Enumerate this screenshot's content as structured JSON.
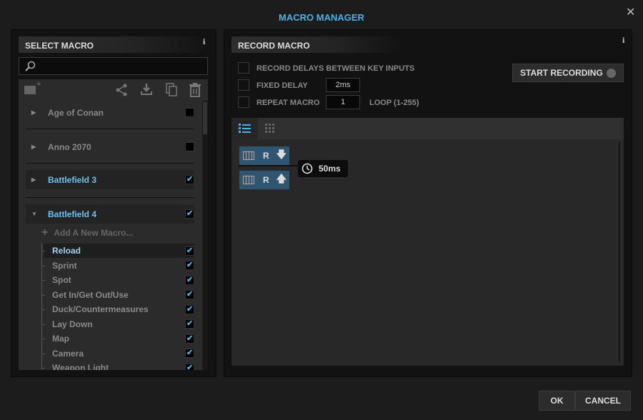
{
  "window": {
    "title": "MACRO MANAGER",
    "close_icon": "close-icon"
  },
  "left": {
    "header": "SELECT MACRO",
    "info": "i",
    "search": {
      "value": "",
      "placeholder": ""
    },
    "toolbar": [
      "new-folder-icon",
      "share-icon",
      "import-icon",
      "copy-icon",
      "trash-icon"
    ],
    "games": [
      {
        "name": "Age of Conan",
        "checked": false,
        "expanded": false
      },
      {
        "name": "Anno 2070",
        "checked": false,
        "expanded": false
      },
      {
        "name": "Battlefield 3",
        "checked": true,
        "expanded": false
      },
      {
        "name": "Battlefield 4",
        "checked": true,
        "expanded": true
      }
    ],
    "add_macro": "Add A New Macro...",
    "macros": [
      "Reload",
      "Sprint",
      "Spot",
      "Get In/Get Out/Use",
      "Duck/Countermeasures",
      "Lay Down",
      "Map",
      "Camera",
      "Weapon Light"
    ],
    "selected_macro": "Reload"
  },
  "right": {
    "header": "RECORD MACRO",
    "info": "i",
    "record_delays": "RECORD DELAYS BETWEEN KEY INPUTS",
    "fixed_delay": "FIXED DELAY",
    "fixed_delay_value": "2ms",
    "repeat_macro": "REPEAT MACRO",
    "repeat_value": "1",
    "loop_label": "LOOP (1-255)",
    "start_recording": "START RECORDING",
    "view_tabs": [
      "list-view-icon",
      "grid-view-icon"
    ],
    "events": [
      {
        "key": "R",
        "direction": "down"
      },
      {
        "key": "R",
        "direction": "up"
      }
    ],
    "delay": "50ms"
  },
  "footer": {
    "ok": "OK",
    "cancel": "CANCEL"
  },
  "colors": {
    "accent": "#4cb2e6",
    "key_block": "#2f5570"
  }
}
